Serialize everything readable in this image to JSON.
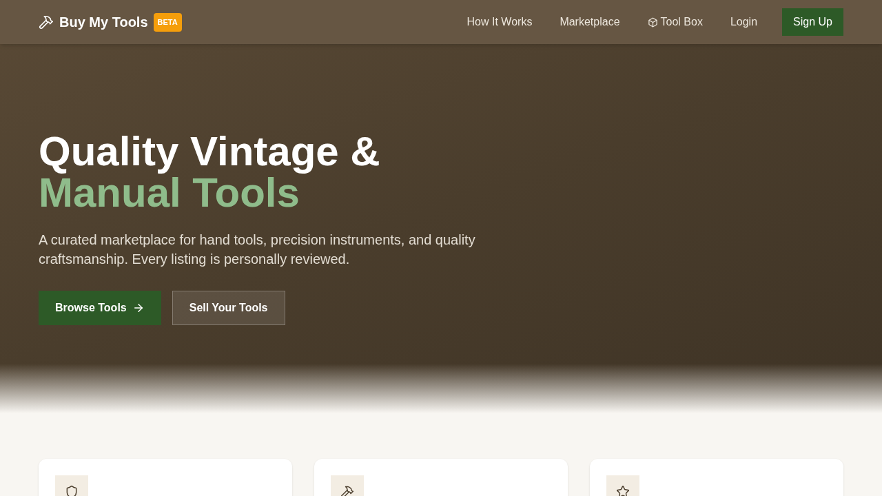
{
  "header": {
    "brand": "Buy My Tools",
    "badge": "BETA",
    "nav": [
      {
        "label": "How It Works",
        "kind": "text"
      },
      {
        "label": "Marketplace",
        "kind": "text"
      },
      {
        "label": "Tool Box",
        "kind": "box"
      },
      {
        "label": "Login",
        "kind": "text"
      },
      {
        "label": "Sign Up",
        "kind": "primary"
      }
    ]
  },
  "hero": {
    "title": "Quality Vintage &",
    "title_accent": "Manual Tools",
    "subtitle": "A curated marketplace for hand tools, precision instruments, and quality craftsmanship. Every listing is personally reviewed.",
    "buttons": [
      {
        "label": "Browse Tools",
        "kind": "primary"
      },
      {
        "label": "Sell Your Tools",
        "kind": "secondary"
      }
    ]
  },
  "features": [
    {
      "kind": "shield"
    },
    {
      "kind": "hammer"
    },
    {
      "kind": "star"
    }
  ]
}
